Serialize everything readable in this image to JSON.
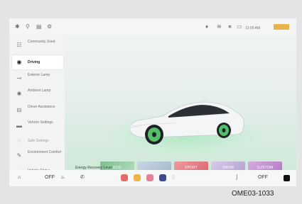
{
  "sidebar": {
    "items": [
      {
        "label": "Community Used",
        "icon": "apps-icon"
      },
      {
        "label": "Driving",
        "icon": "steering-wheel-icon"
      },
      {
        "label": "Exterior Lamp",
        "icon": "headlight-icon"
      },
      {
        "label": "Ambient Lamp",
        "icon": "ambient-light-icon"
      },
      {
        "label": "Driver Assistance",
        "icon": "driver-assist-icon"
      },
      {
        "label": "Vehicle Settings",
        "icon": "car-icon"
      },
      {
        "label": "Safe Settings",
        "icon": "shield-icon"
      },
      {
        "label": "Environment Comfort",
        "icon": "leaf-icon"
      },
      {
        "label": "Vehicle Status",
        "icon": "gauge-icon"
      }
    ],
    "active_index": 1
  },
  "modes": [
    {
      "label": "ECO",
      "color": "#8fc7a2"
    },
    {
      "label": "",
      "color": "#b7c7d6"
    },
    {
      "label": "SPORT",
      "color": "#e8868c"
    },
    {
      "label": "SNOW",
      "color": "#c7b6de"
    },
    {
      "label": "CUSTOM",
      "color": "#c694d6"
    }
  ],
  "energy_recovery_label": "Energy Recovery Level",
  "status": {
    "time": "12:00 AM"
  },
  "bottom": {
    "left_temp": "OFF",
    "right_temp": "OFF"
  },
  "figure_code": "OME03-1033",
  "colors": {
    "accent_green": "#3fb35c",
    "car_body": "#f4f5f6"
  }
}
